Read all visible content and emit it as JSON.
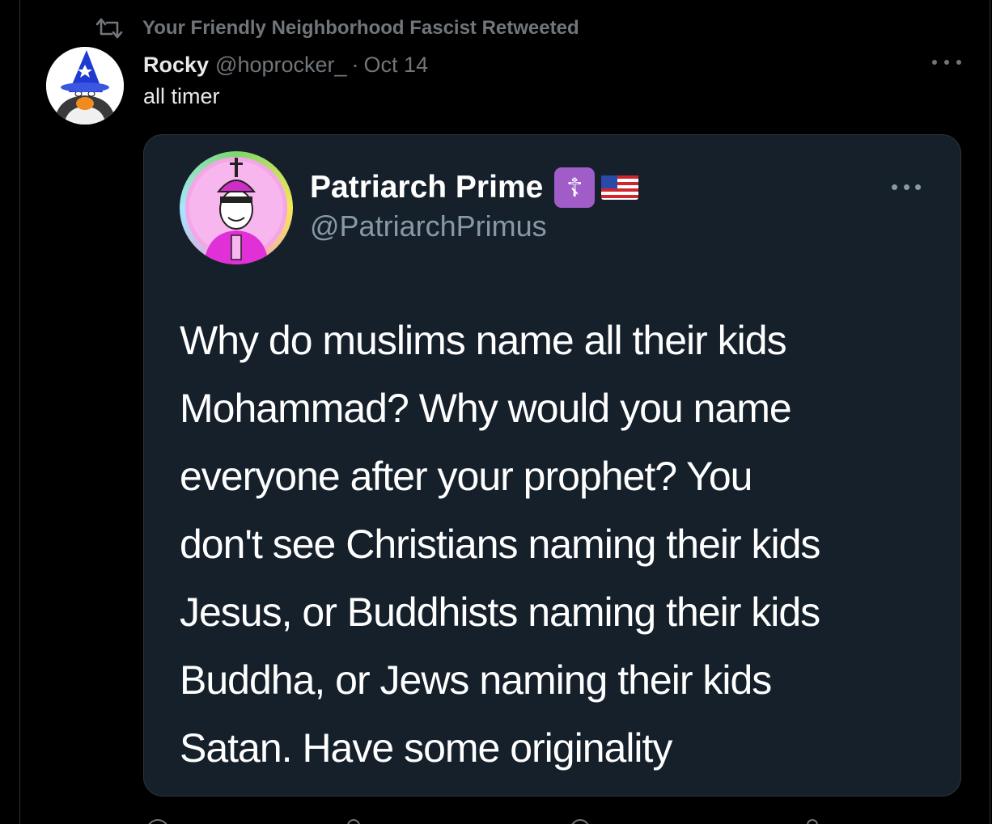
{
  "retweet": {
    "icon": "retweet-icon",
    "text": "Your Friendly Neighborhood Fascist Retweeted"
  },
  "tweet": {
    "author_name": "Rocky",
    "author_handle": "@hoprocker_",
    "separator": "·",
    "date": "Oct 14",
    "text": "all timer",
    "avatar_icon": "penguin-wizard-avatar"
  },
  "quote": {
    "name": "Patriarch Prime",
    "badge_glyph": "☦",
    "flag_icon": "us-flag-icon",
    "handle": "@PatriarchPrimus",
    "avatar_icon": "patriarch-avatar",
    "lines": [
      "Why do muslims name all their kids",
      "Mohammad? Why would you name",
      "everyone after your prophet? You",
      "don't see Christians naming their kids",
      "Jesus, or Buddhists naming their kids",
      "Buddha, or Jews naming their kids",
      "Satan. Have some originality"
    ]
  },
  "colors": {
    "background": "#000000",
    "card": "#15202b",
    "muted": "#71767b",
    "text": "#e7e9ea",
    "badge": "#a05cc7"
  }
}
